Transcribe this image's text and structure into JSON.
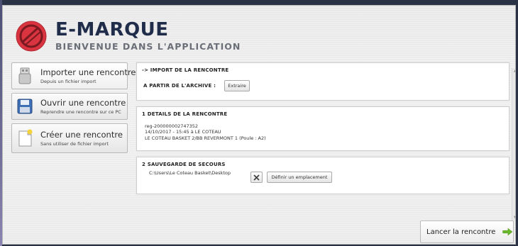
{
  "app": {
    "title": "E-MARQUE",
    "subtitle": "BIENVENUE DANS L'APPLICATION",
    "logo_icon": "e-marque-logo",
    "brand_color": "#d9343f",
    "title_color": "#1f2d4a"
  },
  "sidebar": {
    "items": [
      {
        "label": "Importer une rencontre",
        "sub": "Depuis un fichier import",
        "icon": "usb-drive-icon"
      },
      {
        "label": "Ouvrir une rencontre",
        "sub": "Reprendre une rencontre sur ce PC",
        "icon": "floppy-disk-icon"
      },
      {
        "label": "Créer une rencontre",
        "sub": "Sans utiliser de fichier import",
        "icon": "new-document-icon"
      }
    ]
  },
  "import_panel": {
    "title": "-> IMPORT DE LA RENCONTRE",
    "archive_label": "A PARTIR DE L'ARCHIVE :",
    "extract_button": "Extraire"
  },
  "details_panel": {
    "title": "1  DETAILS DE LA RENCONTRE",
    "line1": "reg-200000002747352",
    "line2": "14/10/2017 - 15:45  à  LE COTEAU",
    "line3": "LE COTEAU BASKET 2/BB REVERMONT 1   (Poule : A2)"
  },
  "backup_panel": {
    "title": "2  SAUVEGARDE DE SECOURS",
    "path": "C:\\Users\\Le Coteau Basket\\Desktop",
    "clear_icon": "close-x-icon",
    "define_button": "Définir un emplacement"
  },
  "footer": {
    "launch_button": "Lancer la rencontre",
    "launch_icon": "green-arrow-icon",
    "accent_green": "#6ab82c"
  }
}
